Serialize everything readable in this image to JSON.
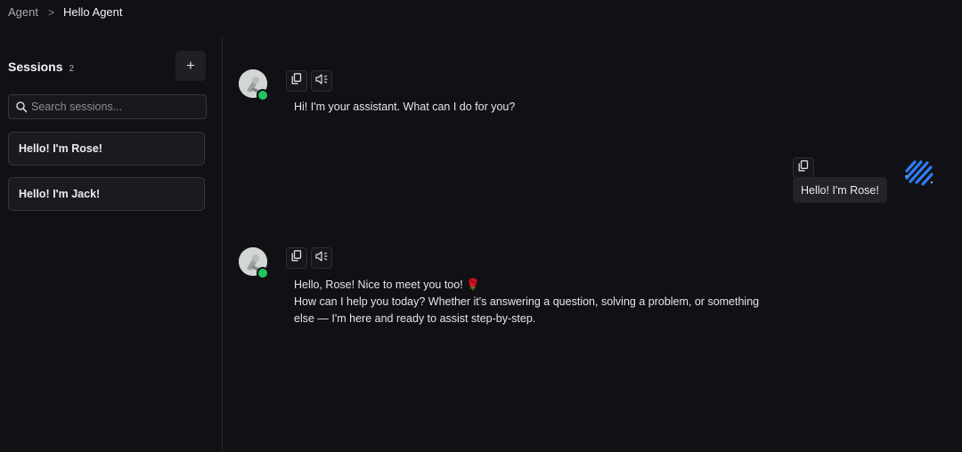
{
  "breadcrumb": {
    "parent": "Agent",
    "separator": ">",
    "current": "Hello Agent"
  },
  "sidebar": {
    "title": "Sessions",
    "count": "2",
    "add_button": "+",
    "search": {
      "placeholder": "Search sessions...",
      "value": ""
    },
    "sessions": [
      {
        "label": "Hello! I'm Rose!"
      },
      {
        "label": "Hello! I'm Jack!"
      }
    ]
  },
  "messages": [
    {
      "role": "assistant",
      "text": "Hi! I'm your assistant. What can I do for you?",
      "icons": [
        "copy-icon",
        "speaker-icon"
      ]
    },
    {
      "role": "user",
      "text": "Hello! I'm Rose!",
      "icons": [
        "copy-icon"
      ]
    },
    {
      "role": "assistant",
      "lines": [
        "Hello, Rose! Nice to meet you too! 🌹",
        "How can I help you today? Whether it's answering a question, solving a problem, or something",
        "else — I'm here and ready to assist step-by-step."
      ],
      "icons": [
        "copy-icon",
        "speaker-icon"
      ]
    }
  ],
  "colors": {
    "background": "#111115",
    "online": "#22c55e",
    "user_logo": "#2f7df6"
  }
}
